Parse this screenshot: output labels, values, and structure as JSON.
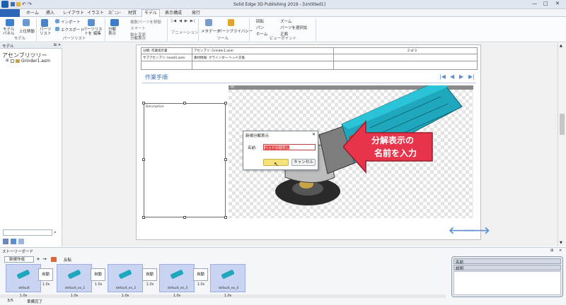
{
  "app": {
    "title": "Solid Edge 3D Publishing 2019 - [Untitled1]"
  },
  "menu": {
    "tabs": [
      "ホーム",
      "挿入",
      "レイアウト",
      "イラスト",
      "ｽﾋﾟﾆｭｰ",
      "材質",
      "モデル",
      "表示構成",
      "発行"
    ],
    "active": "モデル"
  },
  "ribbon": {
    "model_panel": "モデル パネル",
    "move_up": "上位移動",
    "parts_list": "パーツ リスト",
    "import": "インポート",
    "export": "エクスポート",
    "edit_parts_list": "パーツリストを 編集",
    "exploded_view": "分解 表示",
    "multi_parts_move": "複数パーツを移動",
    "smart": "スマート",
    "axis_change": "軸を変更",
    "animation": "アニメーション",
    "metadata": "メタデータ",
    "parts_privacy": "パーツプライバシー",
    "rotate": "回転",
    "pan": "パン",
    "home": "ホーム",
    "zoom": "ズーム",
    "zoom_parts": "パーツを選択拡",
    "frontal": "正面",
    "group_model": "モデル",
    "group_parts_list": "パーツリスト",
    "group_exploded": "分解表示",
    "group_tools": "ツール",
    "group_viewpoint": "ビューポイント"
  },
  "left_panel": {
    "header": "モデル",
    "tree_title": "アセンブリツリー",
    "tree_item": "Grinder1.asm"
  },
  "page": {
    "table": {
      "r1c1": "分類: 作業指示書",
      "r1c2": "アセンブリ: Grinder1.asm",
      "r1c3": "2 of 3",
      "r2c1": "サブアセンブリ: head1.asm",
      "r2c2": "素材情報: グラインダー ヘッド交換"
    },
    "section_title": "作業手順",
    "desc_label": "Description",
    "viewer_tab": "3D"
  },
  "dialog": {
    "title": "新規分解表示",
    "name_label": "名前:",
    "name_value": "ヘッドの取外し",
    "ok": "OK",
    "cancel": "キャンセル"
  },
  "callout": {
    "line1": "分解表示の",
    "line2": "名前を入力"
  },
  "storyboard": {
    "header": "ストーリーボード",
    "new_label": "新規作成",
    "flip_label": "反転",
    "frames": [
      {
        "label": "default",
        "duration": "1.0s"
      },
      {
        "label": "default_ex_1",
        "duration": "1.0s"
      },
      {
        "label": "default_ex_2",
        "duration": "1.0s"
      },
      {
        "label": "default_ex_3",
        "duration": "1.0s"
      },
      {
        "label": "default_ex_4",
        "duration": "1.0s"
      }
    ],
    "transitions": [
      {
        "label": "自動",
        "duration": "1.0s"
      },
      {
        "label": "自動",
        "duration": "1.0s"
      },
      {
        "label": "自動",
        "duration": "1.0s"
      },
      {
        "label": "自動",
        "duration": "1.0s"
      }
    ],
    "status": "準備完了",
    "page_counter": "3/5"
  },
  "properties": {
    "name_label": "名前",
    "desc_label": "説明"
  },
  "colors": {
    "accent": "#5b8fd1",
    "callout": "#e8344a",
    "tool_cyan": "#1fa8bd",
    "titlebar": "#dfe6ef"
  }
}
